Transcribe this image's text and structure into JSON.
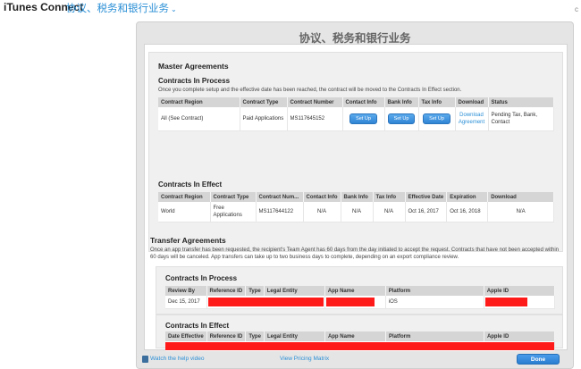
{
  "topbar": {
    "brand": "iTunes Connect",
    "section": "协议、税务和银行业务",
    "right_text": "c"
  },
  "dialog": {
    "title": "协议、税务和银行业务"
  },
  "master": {
    "heading": "Master Agreements",
    "in_process": {
      "heading": "Contracts In Process",
      "description": "Once you complete setup and the effective date has been reached, the contract will be moved to the Contracts In Effect section.",
      "columns": [
        "Contract Region",
        "Contract Type",
        "Contract Number",
        "Contact Info",
        "Bank Info",
        "Tax Info",
        "Download",
        "Status"
      ],
      "row": {
        "region": "All (See Contract)",
        "type": "Paid Applications",
        "number": "MS117645152",
        "contact_btn": "Set Up",
        "bank_btn": "Set Up",
        "tax_btn": "Set Up",
        "download_line1": "Download",
        "download_line2": "Agreement",
        "status": "Pending Tax, Bank, Contact"
      }
    },
    "in_effect": {
      "heading": "Contracts In Effect",
      "columns": [
        "Contract Region",
        "Contract Type",
        "Contract Num...",
        "Contact Info",
        "Bank Info",
        "Tax Info",
        "Effective Date",
        "Expiration",
        "Download"
      ],
      "row": {
        "region": "World",
        "type": "Free Applications",
        "number": "MS117644122",
        "contact": "N/A",
        "bank": "N/A",
        "tax": "N/A",
        "effective": "Oct 16, 2017",
        "expiration": "Oct 16, 2018",
        "download": "N/A"
      }
    }
  },
  "transfer": {
    "heading": "Transfer Agreements",
    "description": "Once an app transfer has been requested, the recipient's Team Agent has 60 days from the day initiated to accept the request. Contracts that have not been accepted within 60 days will be canceled. App transfers can take up to two business days to complete, depending on an export compliance review.",
    "in_process": {
      "heading": "Contracts In Process",
      "columns": [
        "Review By",
        "Reference ID",
        "Type",
        "Legal Entity",
        "App Name",
        "Platform",
        "Apple ID"
      ],
      "row": {
        "review_by": "Dec 15, 2017",
        "platform": "iOS"
      }
    },
    "in_effect": {
      "heading": "Contracts In Effect",
      "columns": [
        "Date Effective",
        "Reference ID",
        "Type",
        "Legal Entity",
        "App Name",
        "Platform",
        "Apple ID"
      ]
    }
  },
  "footer": {
    "help_link": "Watch the help video",
    "pricing_link": "View Pricing Matrix",
    "done_label": "Done"
  },
  "colors": {
    "accent": "#2a8fd6",
    "button_blue": "#2f84d4",
    "redaction": "#ff1a1a"
  }
}
